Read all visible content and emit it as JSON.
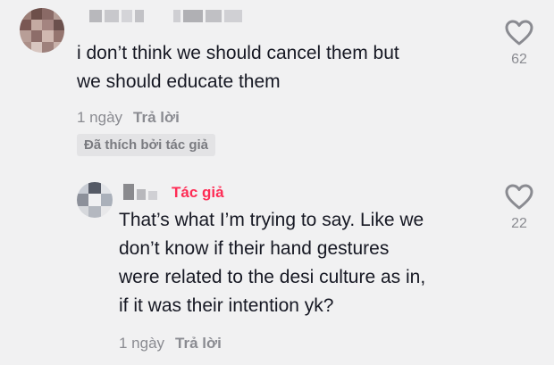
{
  "comments": [
    {
      "text": "i don’t think we should cancel them but\nwe should educate them",
      "time": "1 ngày",
      "reply_label": "Trả lời",
      "liked_by_author": "Đã thích bởi tác giả",
      "likes": "62"
    },
    {
      "author_badge": "Tác giả",
      "text": "That’s what I’m trying to say. Like we\ndon’t know if their hand gestures\nwere related to the desi culture as in,\nif it was their intention yk?",
      "time": "1 ngày",
      "reply_label": "Trả lời",
      "likes": "22"
    }
  ],
  "colors": {
    "background": "#f1f1f2",
    "author_badge": "#fe2c55",
    "muted_text": "#8a8b91"
  },
  "icons": {
    "like": "heart-outline-icon"
  }
}
